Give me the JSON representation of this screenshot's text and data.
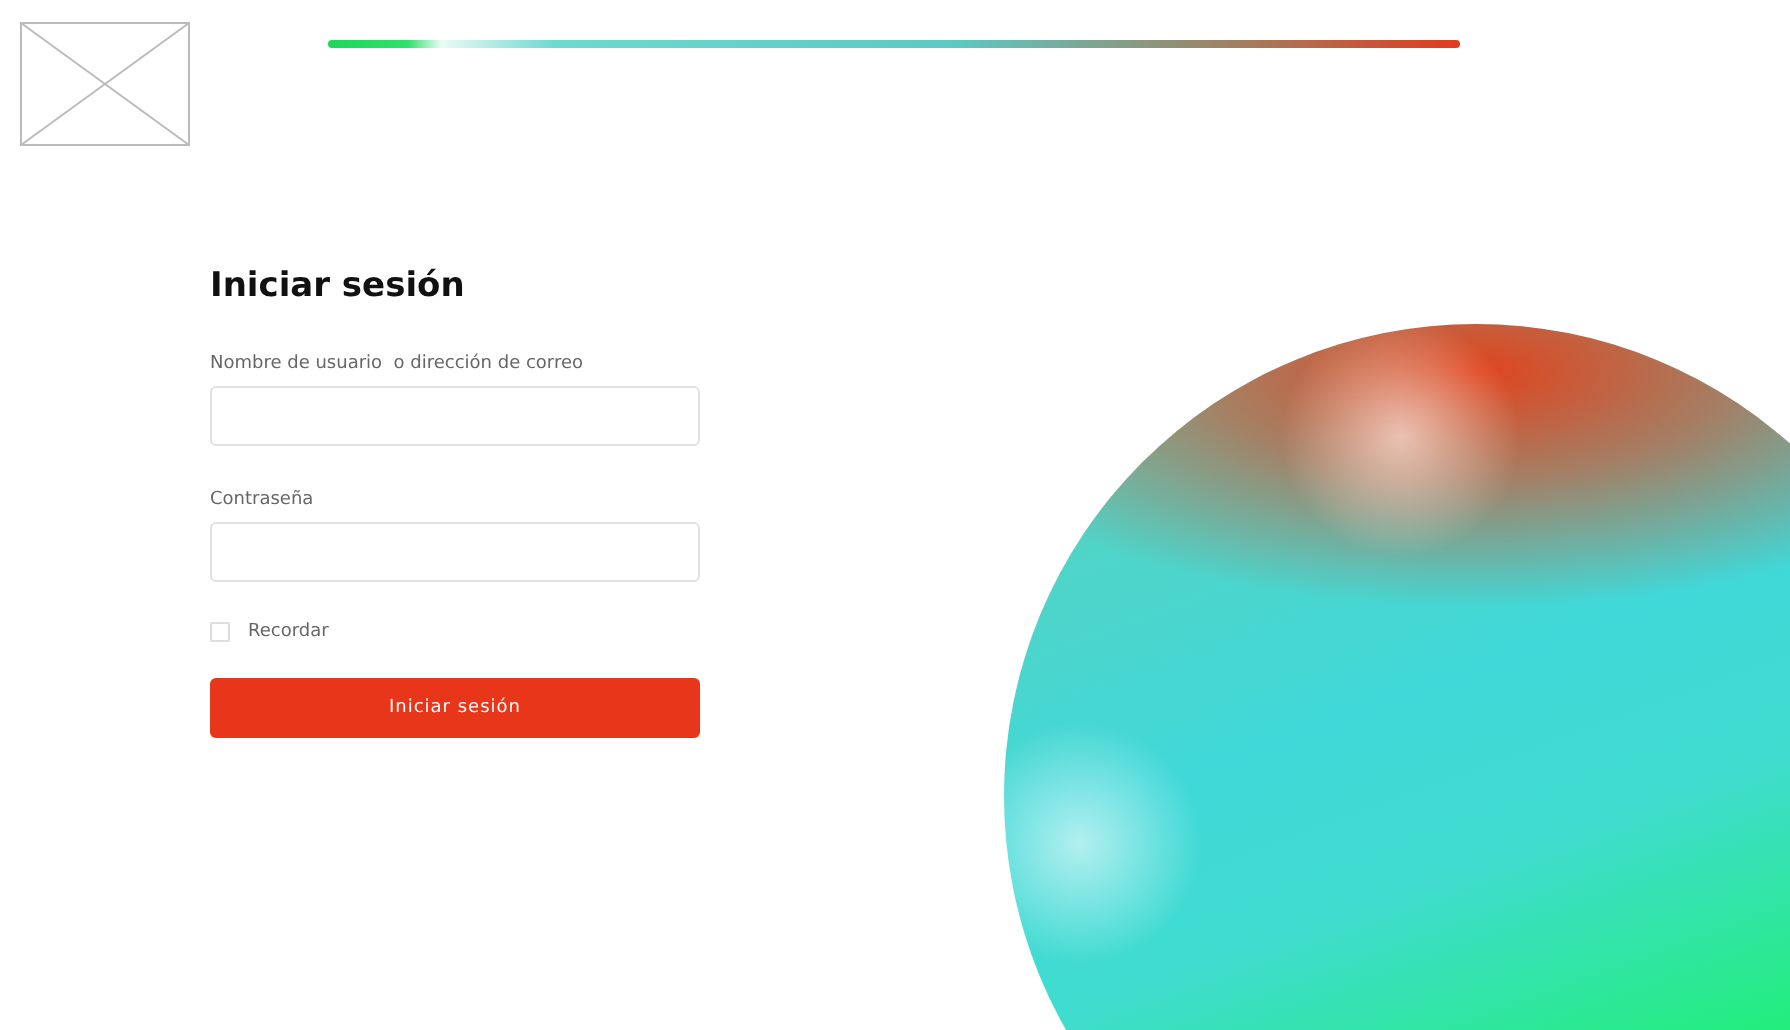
{
  "login": {
    "title": "Iniciar sesión",
    "fields": [
      {
        "label": "Nombre de usuario  o dirección de correo"
      },
      {
        "label": "Contraseña"
      }
    ],
    "remember": {
      "label": "Recordar",
      "checked": false
    },
    "submit": "Iniciar sesión"
  }
}
